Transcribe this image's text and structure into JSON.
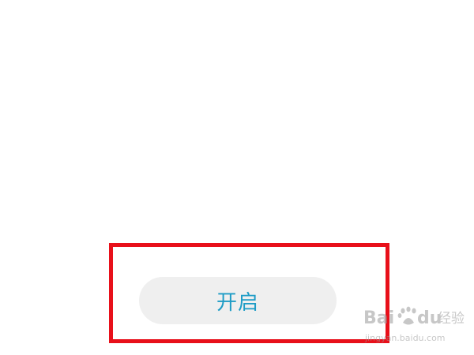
{
  "button": {
    "label": "开启"
  },
  "colors": {
    "background": "#ffffff",
    "button_bg": "#efefef",
    "button_text": "#1e9cc6",
    "highlight_border": "#e8101a",
    "watermark": "#9a9a9a"
  },
  "watermark": {
    "brand": "Bai du 经验",
    "url": "jingyan.baidu.com",
    "icon": "paw-icon"
  }
}
